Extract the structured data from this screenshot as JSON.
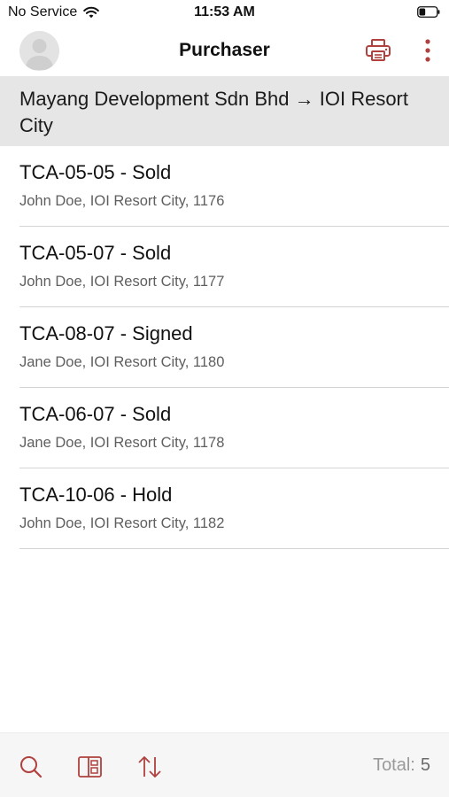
{
  "status_bar": {
    "carrier": "No Service",
    "time": "11:53 AM",
    "icons": [
      "wifi-icon",
      "battery-icon"
    ],
    "battery_level": 0.35
  },
  "nav": {
    "title": "Purchaser",
    "left_icon": "avatar-icon",
    "right_icons": [
      "printer-icon",
      "more-vertical-icon"
    ]
  },
  "section_header": {
    "text": "Mayang Development Sdn Bhd → IOI Resort City"
  },
  "items": [
    {
      "title": "TCA-05-05 - Sold",
      "subtitle": "John Doe, IOI Resort City, 1176"
    },
    {
      "title": "TCA-05-07 - Sold",
      "subtitle": "John Doe, IOI Resort City, 1177"
    },
    {
      "title": "TCA-08-07 - Signed",
      "subtitle": "Jane Doe, IOI Resort City, 1180"
    },
    {
      "title": "TCA-06-07 - Sold",
      "subtitle": "Jane Doe, IOI Resort City, 1178"
    },
    {
      "title": "TCA-10-06 - Hold",
      "subtitle": "John Doe, IOI Resort City, 1182"
    }
  ],
  "toolbar": {
    "icons": [
      "search-icon",
      "layout-icon",
      "sort-icon"
    ],
    "total_label": "Total:",
    "total_count": "5"
  },
  "colors": {
    "accent": "#b0413e",
    "section_bg": "#e6e6e6",
    "toolbar_bg": "#f6f6f6",
    "subtitle": "#5f5f5f"
  }
}
